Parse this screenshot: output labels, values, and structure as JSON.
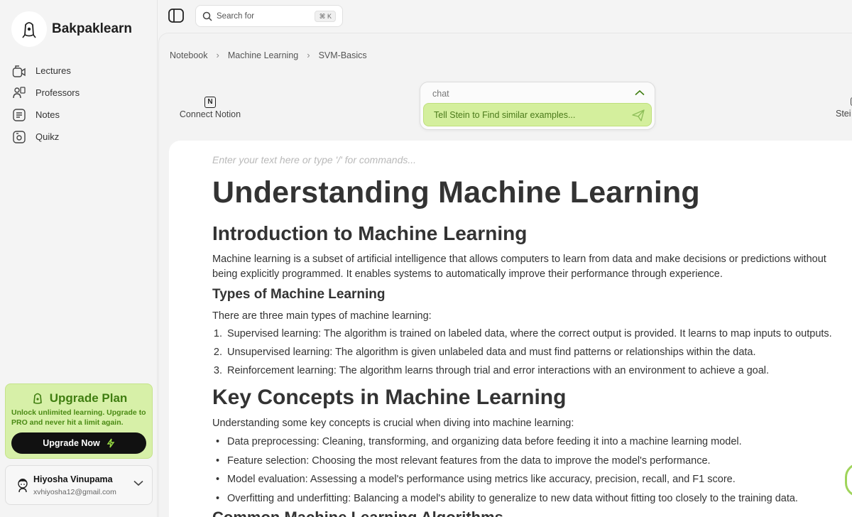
{
  "brand": {
    "name": "Bakpaklearn"
  },
  "sidebar": {
    "items": [
      {
        "label": "Lectures",
        "icon": "lectures-icon"
      },
      {
        "label": "Professors",
        "icon": "professors-icon"
      },
      {
        "label": "Notes",
        "icon": "notes-icon"
      },
      {
        "label": "Quikz",
        "icon": "quiz-icon"
      }
    ]
  },
  "upgrade": {
    "title": "Upgrade Plan",
    "text": "Unlock unlimited learning. Upgrade to PRO and never hit a limit again.",
    "button": "Upgrade Now"
  },
  "user": {
    "name": "Hiyosha Vinupama",
    "email": "xvhiyosha12@gmail.com"
  },
  "search": {
    "label": "Search for",
    "shortcut": "⌘ K"
  },
  "breadcrumb": [
    "Notebook",
    "Machine Learning",
    "SVM-Basics"
  ],
  "toolbar": {
    "notion_label": "Connect Notion",
    "stein_label": "Stei"
  },
  "chat": {
    "label": "chat",
    "input": "Tell Stein to Find similar examples..."
  },
  "doc": {
    "placeholder": "Enter your text here or type '/' for commands...",
    "title": "Understanding Machine Learning",
    "intro_heading": "Introduction to Machine Learning",
    "intro_text": "Machine learning is a subset of artificial intelligence that allows computers to learn from data and make decisions or predictions without being explicitly programmed. It enables systems to automatically improve their performance through experience.",
    "types_heading": "Types of Machine Learning",
    "types_intro": "There are three main types of machine learning:",
    "types": [
      "Supervised learning: The algorithm is trained on labeled data, where the correct output is provided. It learns to map inputs to outputs.",
      "Unsupervised learning: The algorithm is given unlabeled data and must find patterns or relationships within the data.",
      "Reinforcement learning: The algorithm learns through trial and error interactions with an environment to achieve a goal."
    ],
    "concepts_heading": "Key Concepts in Machine Learning",
    "concepts_intro": "Understanding some key concepts is crucial when diving into machine learning:",
    "concepts": [
      "Data preprocessing: Cleaning, transforming, and organizing data before feeding it into a machine learning model.",
      "Feature selection: Choosing the most relevant features from the data to improve the model's performance.",
      "Model evaluation: Assessing a model's performance using metrics like accuracy, precision, recall, and F1 score.",
      "Overfitting and underfitting: Balancing a model's ability to generalize to new data without fitting too closely to the training data."
    ],
    "algorithms_heading": "Common Machine Learning Algorithms"
  },
  "colors": {
    "accent_green": "#d4ef9d",
    "accent_green_text": "#3f7d10",
    "dark_button": "#111111"
  }
}
